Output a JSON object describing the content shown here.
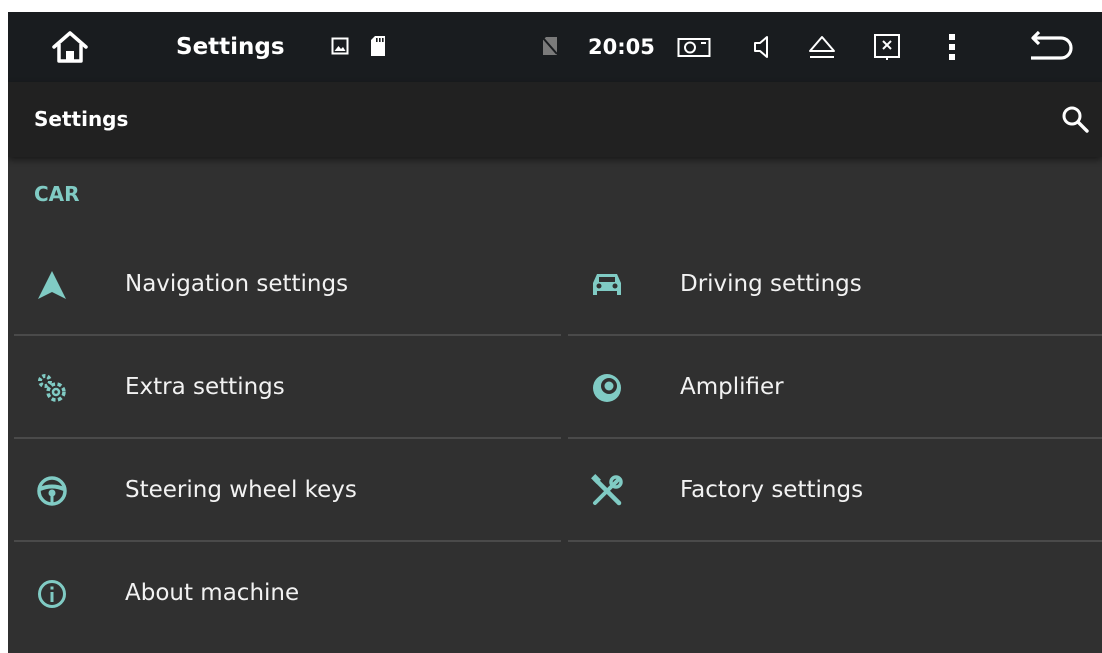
{
  "status_bar": {
    "title": "Settings",
    "time": "20:05",
    "icons": [
      "home-icon",
      "gallery-icon",
      "sd-card-icon",
      "no-sim-icon",
      "screenshot-icon",
      "volume-icon",
      "eject-icon",
      "close-screen-icon",
      "more-vert-icon",
      "back-icon"
    ]
  },
  "action_bar": {
    "title": "Settings",
    "search_icon": "search-icon"
  },
  "section": {
    "header": "CAR"
  },
  "items": [
    {
      "label": "Navigation settings",
      "icon": "navigation-arrow-icon"
    },
    {
      "label": "Driving settings",
      "icon": "car-icon"
    },
    {
      "label": "Extra settings",
      "icon": "gears-icon"
    },
    {
      "label": "Amplifier",
      "icon": "speaker-icon"
    },
    {
      "label": "Steering wheel keys",
      "icon": "steering-wheel-icon"
    },
    {
      "label": "Factory settings",
      "icon": "tools-icon"
    },
    {
      "label": "About machine",
      "icon": "info-icon"
    }
  ],
  "colors": {
    "accent": "#80cbc4",
    "status_bar_bg": "#191c1f",
    "action_bar_bg": "#212121",
    "content_bg": "#303030"
  }
}
